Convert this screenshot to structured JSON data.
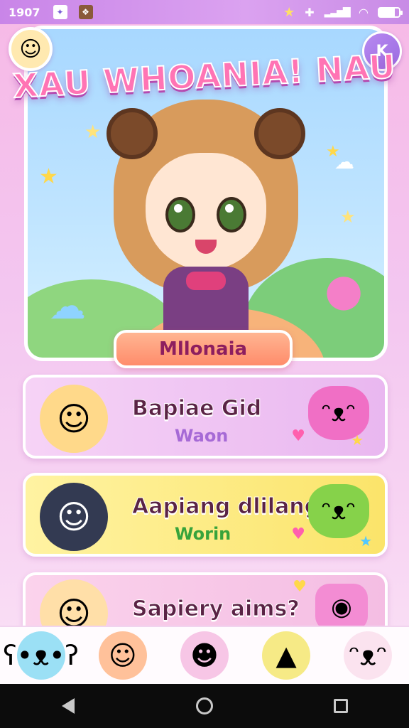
{
  "status_bar": {
    "time": "1907",
    "icons": [
      "app-notification-icon",
      "game-notification-icon",
      "star-icon",
      "sparkle-icon",
      "signal-icon",
      "wifi-icon",
      "battery-icon"
    ],
    "battery_level": 0.8
  },
  "header": {
    "logo_title": "XAU WHOANIA! NAU",
    "badge_label": "K"
  },
  "hero": {
    "name_plate": "Mllonaia"
  },
  "cards": [
    {
      "title": "Bapiae Gid",
      "subtitle": "Waon"
    },
    {
      "title": "Aapiang dlilang",
      "subtitle": "Worin"
    },
    {
      "title": "Sapiery aims?",
      "subtitle": ""
    }
  ],
  "bottom_nav": {
    "items": [
      "blue-bear-character",
      "orange-hair-character",
      "ponytail-character",
      "yellow-party-mascot",
      "white-bunny-mascot"
    ]
  },
  "colors": {
    "accent_pink": "#ff74b4",
    "name_plate": "#ff8c6b",
    "card_purple": "#e9b7f0",
    "card_yellow": "#fbe46a"
  }
}
